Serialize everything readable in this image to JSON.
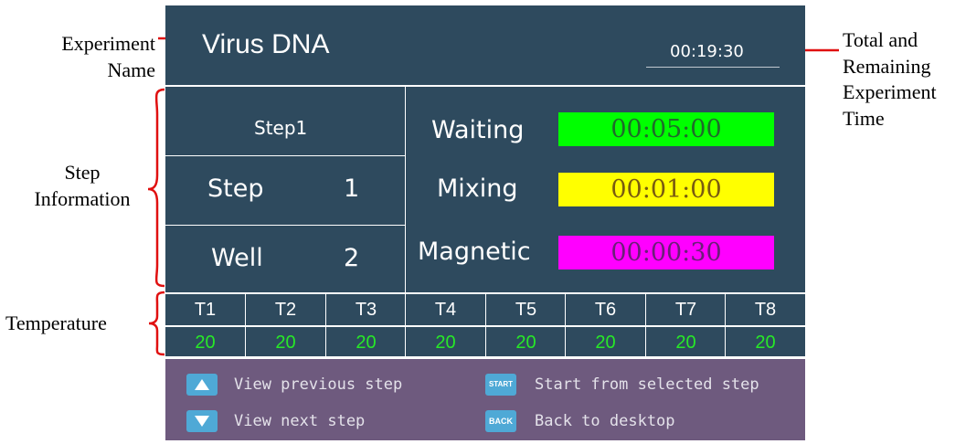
{
  "annotations": {
    "experiment_name": [
      "Experiment",
      "Name"
    ],
    "step_information": [
      "Step",
      "Information"
    ],
    "temperature": "Temperature",
    "time": [
      "Total and",
      "Remaining",
      "Experiment",
      "Time"
    ]
  },
  "header": {
    "experiment_name": "Virus DNA",
    "time": "00:19:30"
  },
  "step_info": {
    "title": "Step1",
    "step_label": "Step",
    "step_value": "1",
    "well_label": "Well",
    "well_value": "2"
  },
  "timers": [
    {
      "label": "Waiting",
      "value": "00:05:00",
      "color": "#00ff00"
    },
    {
      "label": "Mixing",
      "value": "00:01:00",
      "color": "#ffff00"
    },
    {
      "label": "Magnetic",
      "value": "00:00:30",
      "color": "#ff00ff"
    }
  ],
  "temperature": {
    "headers": [
      "T1",
      "T2",
      "T3",
      "T4",
      "T5",
      "T6",
      "T7",
      "T8"
    ],
    "values": [
      "20",
      "20",
      "20",
      "20",
      "20",
      "20",
      "20",
      "20"
    ],
    "value_color": "#27e927"
  },
  "footer": {
    "prev_step": "View previous step",
    "next_step": "View next step",
    "start_selected": "Start from selected step",
    "back_desktop": "Back to desktop",
    "start_icon_text": "START",
    "back_icon_text": "BACK"
  }
}
